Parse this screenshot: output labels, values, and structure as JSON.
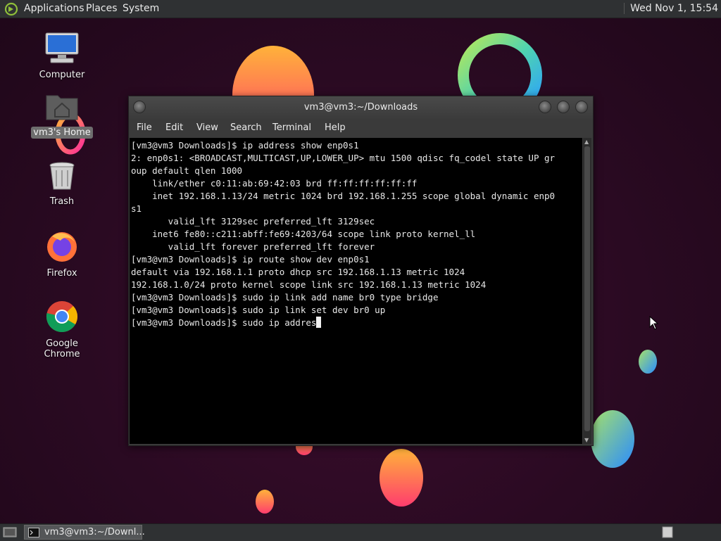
{
  "top_panel": {
    "menus": [
      "Applications",
      "Places",
      "System"
    ],
    "clock": "Wed Nov 1, 15:54"
  },
  "desktop": {
    "icons": [
      {
        "label": "Computer",
        "icon": "computer-icon"
      },
      {
        "label": "vm3's Home",
        "icon": "home-folder-icon",
        "selected": true
      },
      {
        "label": "Trash",
        "icon": "trash-icon"
      },
      {
        "label": "Firefox",
        "icon": "firefox-icon"
      },
      {
        "label": "Google Chrome",
        "icon": "chrome-icon"
      }
    ]
  },
  "terminal": {
    "title": "vm3@vm3:~/Downloads",
    "menu": [
      "File",
      "Edit",
      "View",
      "Search",
      "Terminal",
      "Help"
    ],
    "lines": [
      "[vm3@vm3 Downloads]$ ip address show enp0s1",
      "2: enp0s1: <BROADCAST,MULTICAST,UP,LOWER_UP> mtu 1500 qdisc fq_codel state UP gr",
      "oup default qlen 1000",
      "    link/ether c0:11:ab:69:42:03 brd ff:ff:ff:ff:ff:ff",
      "    inet 192.168.1.13/24 metric 1024 brd 192.168.1.255 scope global dynamic enp0",
      "s1",
      "       valid_lft 3129sec preferred_lft 3129sec",
      "    inet6 fe80::c211:abff:fe69:4203/64 scope link proto kernel_ll",
      "       valid_lft forever preferred_lft forever",
      "[vm3@vm3 Downloads]$ ip route show dev enp0s1",
      "default via 192.168.1.1 proto dhcp src 192.168.1.13 metric 1024",
      "192.168.1.0/24 proto kernel scope link src 192.168.1.13 metric 1024",
      "[vm3@vm3 Downloads]$ sudo ip link add name br0 type bridge",
      "[vm3@vm3 Downloads]$ sudo ip link set dev br0 up"
    ],
    "current_line": "[vm3@vm3 Downloads]$ sudo ip addres"
  },
  "taskbar": {
    "task_label": "vm3@vm3:~/Downl..."
  }
}
